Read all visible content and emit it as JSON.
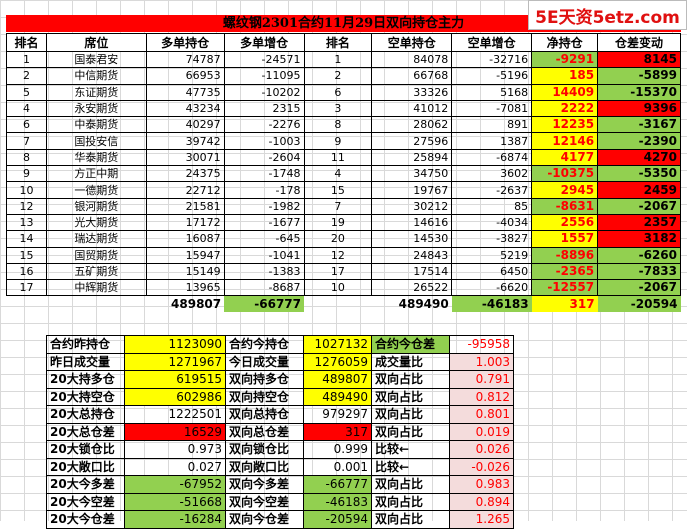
{
  "title": "螺纹钢2301合约11月29日双向持仓主力",
  "watermark": "5E天资5etz.com",
  "headers": [
    "排名",
    "席位",
    "多单持仓",
    "多单增仓",
    "排名",
    "空单持仓",
    "空单增仓",
    "净持仓",
    "仓差变动"
  ],
  "rows": [
    [
      "1",
      "国泰君安",
      "74787",
      "-24571",
      "1",
      "84078",
      "-32716",
      "-9291",
      "8145"
    ],
    [
      "2",
      "中信期货",
      "66953",
      "-11095",
      "2",
      "66768",
      "-5196",
      "185",
      "-5899"
    ],
    [
      "5",
      "东证期货",
      "47735",
      "-10202",
      "6",
      "33326",
      "5168",
      "14409",
      "-15370"
    ],
    [
      "4",
      "永安期货",
      "43234",
      "2315",
      "3",
      "41012",
      "-7081",
      "2222",
      "9396"
    ],
    [
      "6",
      "中泰期货",
      "40297",
      "-2276",
      "8",
      "28062",
      "891",
      "12235",
      "-3167"
    ],
    [
      "7",
      "国投安信",
      "39742",
      "-1003",
      "9",
      "27596",
      "1387",
      "12146",
      "-2390"
    ],
    [
      "8",
      "华泰期货",
      "30071",
      "-2604",
      "11",
      "25894",
      "-6874",
      "4177",
      "4270"
    ],
    [
      "9",
      "方正中期",
      "24375",
      "-1748",
      "4",
      "34750",
      "3602",
      "-10375",
      "-5350"
    ],
    [
      "10",
      "一德期货",
      "22712",
      "-178",
      "15",
      "19767",
      "-2637",
      "2945",
      "2459"
    ],
    [
      "12",
      "银河期货",
      "21581",
      "-1982",
      "7",
      "30212",
      "85",
      "-8631",
      "-2067"
    ],
    [
      "13",
      "光大期货",
      "17172",
      "-1677",
      "19",
      "14616",
      "-4034",
      "2556",
      "2357"
    ],
    [
      "14",
      "瑞达期货",
      "16087",
      "-645",
      "20",
      "14530",
      "-3827",
      "1557",
      "3182"
    ],
    [
      "15",
      "国贸期货",
      "15947",
      "-1041",
      "12",
      "24843",
      "5219",
      "-8896",
      "-6260"
    ],
    [
      "16",
      "五矿期货",
      "15149",
      "-1383",
      "17",
      "17514",
      "6450",
      "-2365",
      "-7833"
    ],
    [
      "17",
      "中辉期货",
      "13965",
      "-8687",
      "10",
      "26522",
      "-6620",
      "-12557",
      "-2067"
    ]
  ],
  "net_colors": [
    "g",
    "y",
    "y",
    "y",
    "y",
    "y",
    "y",
    "g",
    "y",
    "g",
    "y",
    "y",
    "g",
    "g",
    "g"
  ],
  "diff_colors": [
    "red",
    "g",
    "g",
    "red",
    "g",
    "g",
    "red",
    "g",
    "red",
    "g",
    "red",
    "red",
    "g",
    "g",
    "g"
  ],
  "totals": [
    "489807",
    "-66777",
    "489490",
    "-46183",
    "317",
    "-20594"
  ],
  "stats": [
    [
      "合约昨持仓",
      "1123090",
      "合约今持仓",
      "1027132",
      "合约今仓差",
      "-95958"
    ],
    [
      "昨日成交量",
      "1271967",
      "今日成交量",
      "1276059",
      "成交量比",
      "1.003"
    ],
    [
      "20大持多仓",
      "619515",
      "双向持多仓",
      "489807",
      "双向占比",
      "0.791"
    ],
    [
      "20大持空仓",
      "602986",
      "双向持空仓",
      "489490",
      "双向占比",
      "0.812"
    ],
    [
      "20大总持仓",
      "1222501",
      "双向总持仓",
      "979297",
      "双向占比",
      "0.801"
    ],
    [
      "20大总仓差",
      "16529",
      "双向总仓差",
      "317",
      "双向占比",
      "0.019"
    ],
    [
      "20大锁仓比",
      "0.973",
      "双向锁仓比",
      "0.999",
      "比较←",
      "0.026"
    ],
    [
      "20大敞口比",
      "0.027",
      "双向敞口比",
      "0.001",
      "比较←",
      "-0.026"
    ],
    [
      "20大今多差",
      "-67952",
      "双向今多差",
      "-66777",
      "双向占比",
      "0.983"
    ],
    [
      "20大今空差",
      "-51668",
      "双向今空差",
      "-46183",
      "双向占比",
      "0.894"
    ],
    [
      "20大今仓差",
      "-16284",
      "双向今仓差",
      "-20594",
      "双向占比",
      "1.265"
    ]
  ],
  "stat_colors": [
    [
      "",
      "y",
      "",
      "y",
      "g",
      ""
    ],
    [
      "",
      "y",
      "",
      "y",
      "pink",
      ""
    ],
    [
      "",
      "y",
      "",
      "y",
      "pink",
      ""
    ],
    [
      "",
      "y",
      "",
      "y",
      "pink",
      ""
    ],
    [
      "",
      "",
      "",
      "",
      "pink",
      ""
    ],
    [
      "",
      "red",
      "",
      "red",
      "pink",
      ""
    ],
    [
      "",
      "",
      "",
      "",
      "pink",
      ""
    ],
    [
      "",
      "",
      "",
      "",
      "pink",
      ""
    ],
    [
      "",
      "g",
      "",
      "g",
      "pink",
      ""
    ],
    [
      "",
      "g",
      "",
      "g",
      "pink",
      ""
    ],
    [
      "",
      "g",
      "",
      "g",
      "pink",
      ""
    ]
  ]
}
